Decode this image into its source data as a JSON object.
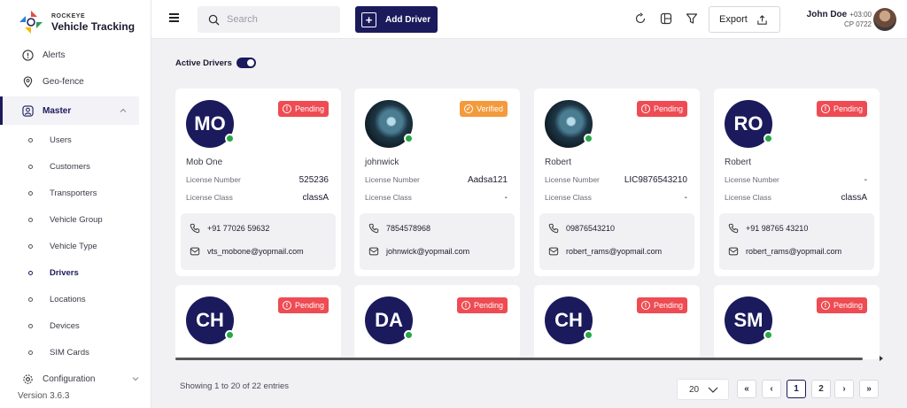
{
  "brand": {
    "top": "ROCKEYE",
    "name": "Vehicle Tracking"
  },
  "nav": {
    "alerts": "Alerts",
    "geofence": "Geo-fence",
    "master": "Master",
    "sub": [
      "Users",
      "Customers",
      "Transporters",
      "Vehicle Group",
      "Vehicle Type",
      "Drivers",
      "Locations",
      "Devices",
      "SIM Cards"
    ],
    "configuration": "Configuration"
  },
  "version": "Version 3.6.3",
  "header": {
    "search_placeholder": "Search",
    "add_driver": "Add Driver",
    "export": "Export",
    "user_name": "John Doe",
    "user_tz": "+03:00",
    "user_role": "CP 0722"
  },
  "filter": {
    "label": "Active Drivers",
    "enabled": true
  },
  "labels": {
    "license_number": "License Number",
    "license_class": "License Class"
  },
  "drivers": [
    {
      "initials": "MO",
      "name": "Mob One",
      "status": "Pending",
      "license_number": "525236",
      "license_class": "classA",
      "phone": "+91 77026 59632",
      "email": "vts_mobone@yopmail.com"
    },
    {
      "initials": "",
      "name": "johnwick",
      "status": "Verified",
      "license_number": "Aadsa121",
      "license_class": "-",
      "phone": "7854578968",
      "email": "johnwick@yopmail.com"
    },
    {
      "initials": "",
      "name": "Robert",
      "status": "Pending",
      "license_number": "LIC9876543210",
      "license_class": "-",
      "phone": "09876543210",
      "email": "robert_rams@yopmail.com"
    },
    {
      "initials": "RO",
      "name": "Robert",
      "status": "Pending",
      "license_number": "-",
      "license_class": "classA",
      "phone": "+91 98765 43210",
      "email": "robert_rams@yopmail.com"
    },
    {
      "initials": "CH",
      "status": "Pending"
    },
    {
      "initials": "DA",
      "status": "Pending"
    },
    {
      "initials": "CH",
      "status": "Pending"
    },
    {
      "initials": "SM",
      "status": "Pending"
    }
  ],
  "pagination": {
    "info": "Showing 1 to 20 of 22 entries",
    "page_size": "20",
    "first": "«",
    "prev": "‹",
    "page1": "1",
    "page2": "2",
    "next": "›",
    "last": "»"
  },
  "colors": {
    "primary": "#1b1a5c",
    "pending": "#ee4b53",
    "verified": "#f39a3c",
    "online": "#27a745"
  }
}
